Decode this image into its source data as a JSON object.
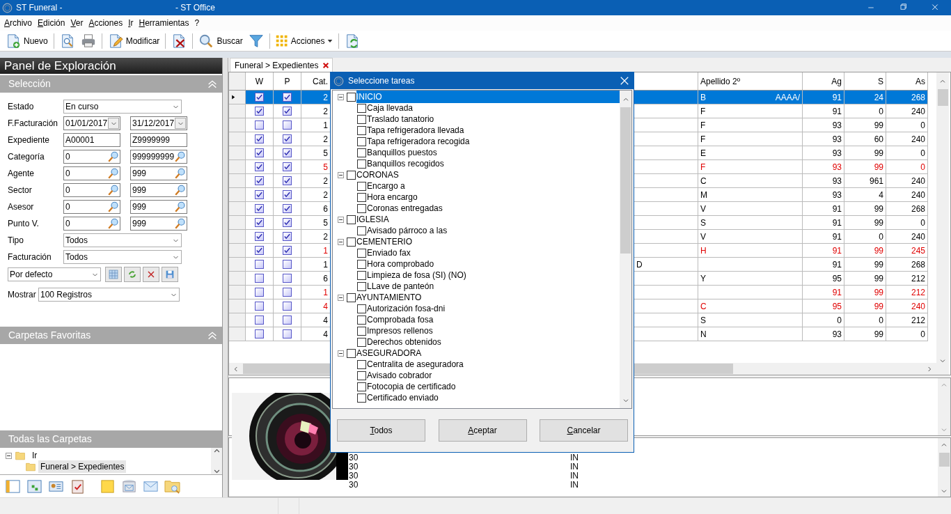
{
  "window": {
    "title_left": "ST Funeral -",
    "title_right": "- ST Office"
  },
  "menu": [
    "Archivo",
    "Edición",
    "Ver",
    "Acciones",
    "Ir",
    "Herramientas",
    "?"
  ],
  "toolbar": [
    {
      "kind": "button",
      "label": "Nuevo"
    },
    {
      "kind": "separator"
    },
    {
      "kind": "button"
    },
    {
      "kind": "button"
    },
    {
      "kind": "separator"
    },
    {
      "kind": "button",
      "label": "Modificar"
    },
    {
      "kind": "separator"
    },
    {
      "kind": "button"
    },
    {
      "kind": "separator"
    },
    {
      "kind": "button",
      "label": "Buscar"
    },
    {
      "kind": "button"
    },
    {
      "kind": "separator"
    },
    {
      "kind": "dropdown",
      "label": "Acciones"
    },
    {
      "kind": "separator"
    },
    {
      "kind": "button"
    }
  ],
  "explorer": {
    "title": "Panel de Exploración",
    "selection_title": "Selección",
    "favorites_title": "Carpetas Favoritas",
    "all_folders_title": "Todas las Carpetas",
    "filters": [
      {
        "kind": "select",
        "label": "Estado",
        "value": "En curso"
      },
      {
        "kind": "date_range",
        "label": "F.Facturación",
        "from": "01/01/2017",
        "to": "31/12/2017"
      },
      {
        "kind": "text_range",
        "label": "Expediente",
        "from": "A00001",
        "to": "Z9999999"
      },
      {
        "kind": "lookup_range",
        "label": "Categoría",
        "from": "0",
        "to": "999999999"
      },
      {
        "kind": "lookup_range",
        "label": "Agente",
        "from": "0",
        "to": "999"
      },
      {
        "kind": "lookup_range",
        "label": "Sector",
        "from": "0",
        "to": "999"
      },
      {
        "kind": "lookup_range",
        "label": "Asesor",
        "from": "0",
        "to": "999"
      },
      {
        "kind": "lookup_range",
        "label": "Punto V.",
        "from": "0",
        "to": "999"
      },
      {
        "kind": "select",
        "label": "Tipo",
        "value": "Todos"
      },
      {
        "kind": "select",
        "label": "Facturación",
        "value": "Todos"
      },
      {
        "kind": "view_select",
        "value": "Por defecto"
      },
      {
        "kind": "inline_select",
        "label": "Mostrar",
        "value": "100  Registros"
      }
    ],
    "folders": [
      {
        "label": "Ir",
        "expanded": true,
        "selected": false,
        "children": [
          {
            "label": "Funeral > Expedientes",
            "selected": true
          }
        ]
      }
    ]
  },
  "tabs": [
    {
      "label": "Funeral > Expedientes",
      "selected": true
    }
  ],
  "grid": {
    "headers": {
      "w": "W",
      "p": "P",
      "cat": "Cat.",
      "apellido_2": "Apellido 2º",
      "ag": "Ag",
      "s": "S",
      "as": "As"
    },
    "rows": [
      {
        "selected": true,
        "alert": false,
        "w": true,
        "p": true,
        "cat": "2",
        "apellido_2": "B",
        "apellido_2_tail": "AAAA/",
        "ag": "91",
        "s": "24",
        "as": "268"
      },
      {
        "selected": false,
        "alert": false,
        "w": true,
        "p": true,
        "cat": "2",
        "apellido_2": "F",
        "ag": "91",
        "s": "0",
        "as": "240"
      },
      {
        "selected": false,
        "alert": false,
        "w": false,
        "p": false,
        "cat": "1",
        "apellido_2": "F",
        "ag": "93",
        "s": "99",
        "as": "0"
      },
      {
        "selected": false,
        "alert": false,
        "w": true,
        "p": true,
        "cat": "2",
        "apellido_2": "F",
        "ag": "93",
        "s": "60",
        "as": "240"
      },
      {
        "selected": false,
        "alert": false,
        "w": true,
        "p": true,
        "cat": "5",
        "apellido_2": "E",
        "ag": "93",
        "s": "99",
        "as": "0"
      },
      {
        "selected": false,
        "alert": true,
        "w": true,
        "p": true,
        "cat": "5",
        "apellido_2": "F",
        "ag": "93",
        "s": "99",
        "as": "0"
      },
      {
        "selected": false,
        "alert": false,
        "w": true,
        "p": true,
        "cat": "2",
        "apellido_2": "C",
        "ag": "93",
        "s": "961",
        "as": "240"
      },
      {
        "selected": false,
        "alert": false,
        "w": true,
        "p": true,
        "cat": "2",
        "apellido_2": "M",
        "ag": "93",
        "s": "4",
        "as": "240"
      },
      {
        "selected": false,
        "alert": false,
        "w": true,
        "p": true,
        "cat": "6",
        "apellido_2": "V",
        "ag": "91",
        "s": "99",
        "as": "268"
      },
      {
        "selected": false,
        "alert": false,
        "w": true,
        "p": true,
        "cat": "5",
        "apellido_2": "S",
        "ag": "91",
        "s": "99",
        "as": "0"
      },
      {
        "selected": false,
        "alert": false,
        "w": true,
        "p": true,
        "cat": "2",
        "apellido_2": "V",
        "ag": "91",
        "s": "0",
        "as": "240"
      },
      {
        "selected": false,
        "alert": true,
        "w": true,
        "p": true,
        "cat": "1",
        "apellido_2": "H",
        "ag": "91",
        "s": "99",
        "as": "245"
      },
      {
        "selected": false,
        "alert": false,
        "w": false,
        "p": false,
        "cat": "1",
        "column_5": "D",
        "ag": "91",
        "s": "99",
        "as": "268"
      },
      {
        "selected": false,
        "alert": false,
        "w": false,
        "p": false,
        "cat": "6",
        "apellido_2": "Y",
        "ag": "95",
        "s": "99",
        "as": "212"
      },
      {
        "selected": false,
        "alert": true,
        "w": false,
        "p": false,
        "cat": "1",
        "ag": "91",
        "s": "99",
        "as": "212"
      },
      {
        "selected": false,
        "alert": true,
        "w": false,
        "p": false,
        "cat": "4",
        "apellido_2": "C",
        "ag": "95",
        "s": "99",
        "as": "240"
      },
      {
        "selected": false,
        "alert": false,
        "w": false,
        "p": false,
        "cat": "4",
        "apellido_2": "S",
        "ag": "0",
        "s": "0",
        "as": "212"
      },
      {
        "selected": false,
        "alert": false,
        "w": false,
        "p": false,
        "cat": "4",
        "apellido_2": "N",
        "ag": "93",
        "s": "99",
        "as": "0"
      }
    ]
  },
  "detail_rows": [
    {
      "column_1": "30",
      "column_2": "IN"
    },
    {
      "column_1": "30",
      "column_2": "IN"
    },
    {
      "column_1": "30",
      "column_2": "IN"
    },
    {
      "column_1": "30",
      "column_2": "IN"
    }
  ],
  "dialog": {
    "title": "Seleccione tareas",
    "buttons": [
      "Todos",
      "Aceptar",
      "Cancelar"
    ],
    "groups": [
      {
        "label": "INICIO",
        "expanded": true,
        "checked": false,
        "selected": true,
        "children": [
          {
            "label": "Caja llevada",
            "checked": false,
            "selected": false
          },
          {
            "label": "Traslado tanatorio",
            "checked": false,
            "selected": false
          },
          {
            "label": "Tapa refrigeradora llevada",
            "checked": false,
            "selected": false
          },
          {
            "label": "Tapa refrigeradora recogida",
            "checked": false,
            "selected": false
          },
          {
            "label": "Banquillos puestos",
            "checked": false,
            "selected": false
          },
          {
            "label": "Banquillos recogidos",
            "checked": false,
            "selected": false
          }
        ]
      },
      {
        "label": "CORONAS",
        "expanded": true,
        "checked": false,
        "selected": false,
        "children": [
          {
            "label": "Encargo a",
            "checked": false,
            "selected": false
          },
          {
            "label": "Hora encargo",
            "checked": false,
            "selected": false
          },
          {
            "label": "Coronas entregadas",
            "checked": false,
            "selected": false
          }
        ]
      },
      {
        "label": "IGLESIA",
        "expanded": true,
        "checked": false,
        "selected": false,
        "children": [
          {
            "label": "Avisado párroco a las",
            "checked": false,
            "selected": false
          }
        ]
      },
      {
        "label": "CEMENTERIO",
        "expanded": true,
        "checked": false,
        "selected": false,
        "children": [
          {
            "label": "Enviado fax",
            "checked": false,
            "selected": false
          },
          {
            "label": "Hora comprobado",
            "checked": false,
            "selected": false
          },
          {
            "label": "Limpieza de fosa (SI) (NO)",
            "checked": false,
            "selected": false
          },
          {
            "label": "LLave de panteón",
            "checked": false,
            "selected": false
          }
        ]
      },
      {
        "label": "AYUNTAMIENTO",
        "expanded": true,
        "checked": false,
        "selected": false,
        "children": [
          {
            "label": "Autorización fosa-dni",
            "checked": false,
            "selected": false
          },
          {
            "label": "Comprobada fosa",
            "checked": false,
            "selected": false
          },
          {
            "label": "Impresos rellenos",
            "checked": false,
            "selected": false
          },
          {
            "label": "Derechos obtenidos",
            "checked": false,
            "selected": false
          }
        ]
      },
      {
        "label": "ASEGURADORA",
        "expanded": true,
        "checked": false,
        "selected": false,
        "children": [
          {
            "label": "Centralita de aseguradora",
            "checked": false,
            "selected": false
          },
          {
            "label": "Avisado cobrador",
            "checked": false,
            "selected": false
          },
          {
            "label": "Fotocopia de certificado",
            "checked": false,
            "selected": false
          },
          {
            "label": "Certificado enviado",
            "checked": false,
            "selected": false
          }
        ]
      }
    ]
  }
}
